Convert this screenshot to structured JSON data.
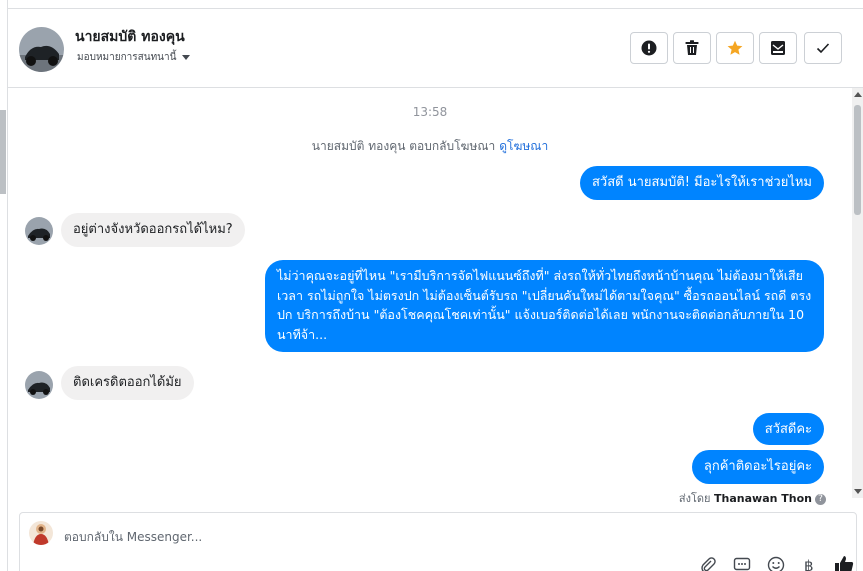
{
  "header": {
    "contact_name": "นายสมบัติ ทองคุน",
    "assign_label": "มอบหมายการสนทนานี้"
  },
  "actions": [
    {
      "name": "spam-icon"
    },
    {
      "name": "trash-icon"
    },
    {
      "name": "star-icon",
      "color": "#f5a623"
    },
    {
      "name": "mark-unread-icon"
    },
    {
      "name": "checkmark-icon"
    }
  ],
  "conversation": {
    "timestamp": "13:58",
    "ad_reply_text": "นายสมบัติ ทองคุน ตอบกลับโฆษณา",
    "ad_reply_link": "ดูโฆษณา",
    "messages": [
      {
        "from": "page",
        "text": "สวัสดี นายสมบัติ! มีอะไรให้เราช่วยไหม"
      },
      {
        "from": "user",
        "text": "อยู่ต่างจังหวัดออกรถได้ไหม?"
      },
      {
        "from": "page",
        "text": "ไม่ว่าคุณจะอยู่ที่ไหน \"เรามีบริการจัดไฟแนนซ์ถึงที่\"  ส่งรถให้ทั่วไทยถึงหน้าบ้านคุณ ไม่ต้องมาให้เสียเวลา รถไม่ถูกใจ ไม่ตรงปก ไม่ต้องเซ็นต์รับรถ \"เปลี่ยนคันใหม่ได้ตามใจคุณ\" ซื้อรถออนไลน์ รถดี ตรงปก บริการถึงบ้าน \"ต้องโชคคุณโชคเท่านั้น\" แจ้งเบอร์ติดต่อได้เลย พนักงานจะติดต่อกลับภายใน 10 นาทีจ้า..."
      },
      {
        "from": "user",
        "text": "ติดเครดิตออกได้มัย"
      },
      {
        "from": "page",
        "text": "สวัสดีคะ"
      },
      {
        "from": "page",
        "text": "ลุกค้าติดอะไรอยู่คะ"
      }
    ],
    "sent_by_prefix": "ส่งโดย",
    "sent_by_name": "Thanawan Thon"
  },
  "composer": {
    "placeholder": "ตอบกลับใน Messenger...",
    "tools": [
      "attachment-icon",
      "saved-reply-icon",
      "emoji-icon",
      "baht-icon",
      "thumbs-up-icon"
    ]
  },
  "colors": {
    "outgoing_bubble": "#0084ff",
    "incoming_bubble": "#f1f0f0",
    "link": "#216fdb"
  }
}
